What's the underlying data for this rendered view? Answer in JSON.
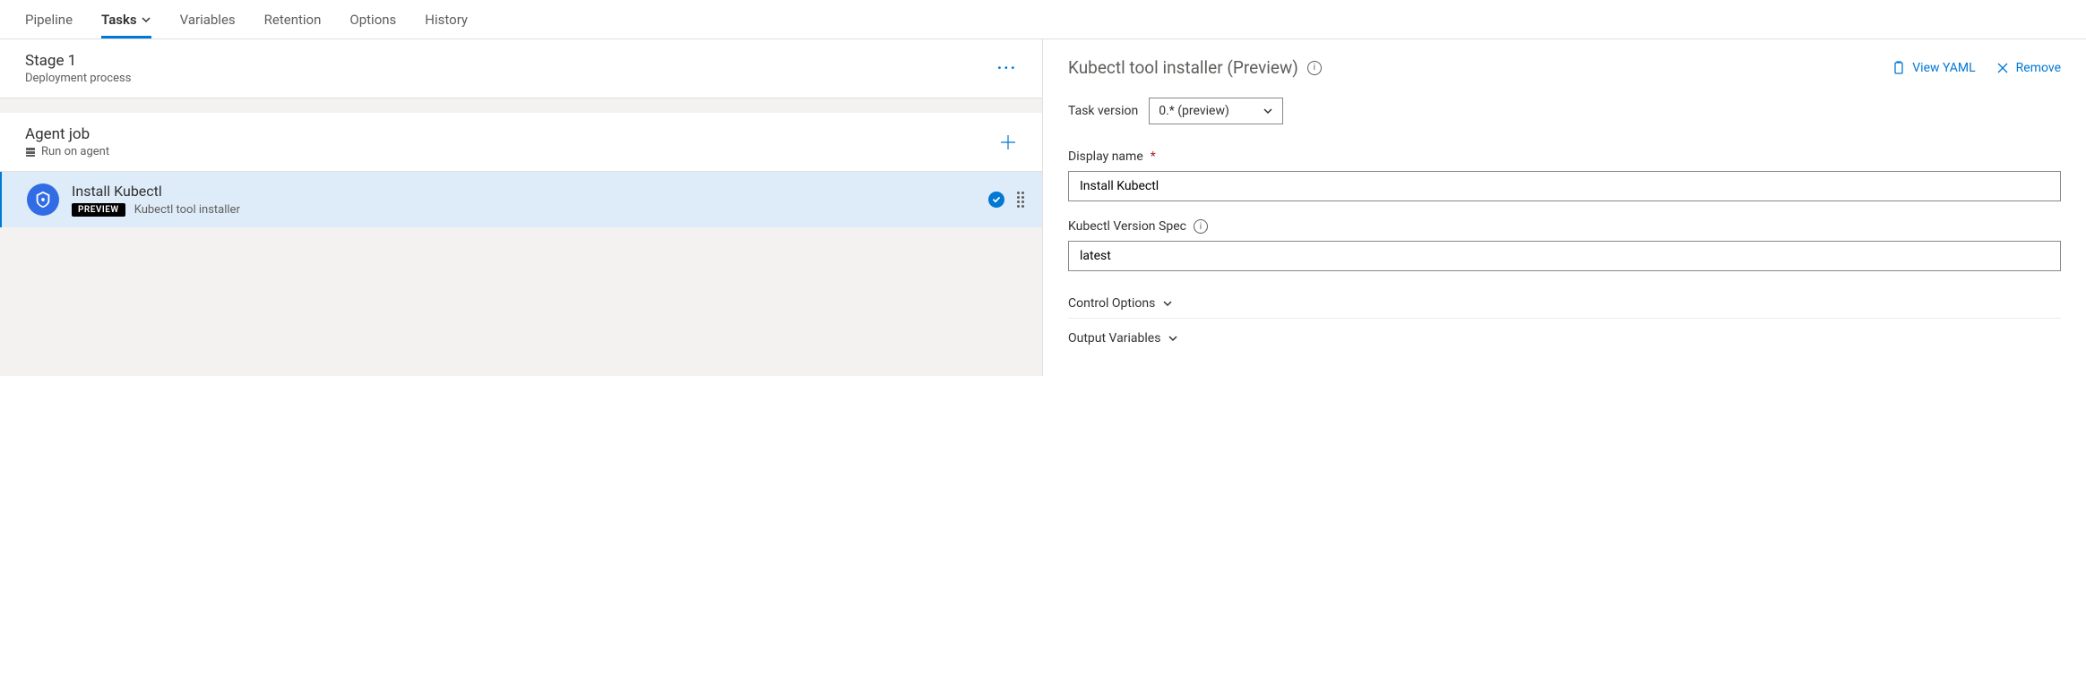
{
  "tabs": {
    "pipeline": "Pipeline",
    "tasks": "Tasks",
    "variables": "Variables",
    "retention": "Retention",
    "options": "Options",
    "history": "History"
  },
  "stage": {
    "title": "Stage 1",
    "subtitle": "Deployment process"
  },
  "agentJob": {
    "title": "Agent job",
    "subtitle": "Run on agent"
  },
  "task": {
    "name": "Install Kubectl",
    "badge": "PREVIEW",
    "desc": "Kubectl tool installer"
  },
  "detail": {
    "title": "Kubectl tool installer (Preview)",
    "viewYaml": "View YAML",
    "remove": "Remove",
    "taskVersionLabel": "Task version",
    "taskVersionValue": "0.* (preview)",
    "displayNameLabel": "Display name",
    "displayNameValue": "Install Kubectl",
    "versionSpecLabel": "Kubectl Version Spec",
    "versionSpecValue": "latest",
    "controlOptions": "Control Options",
    "outputVariables": "Output Variables"
  }
}
